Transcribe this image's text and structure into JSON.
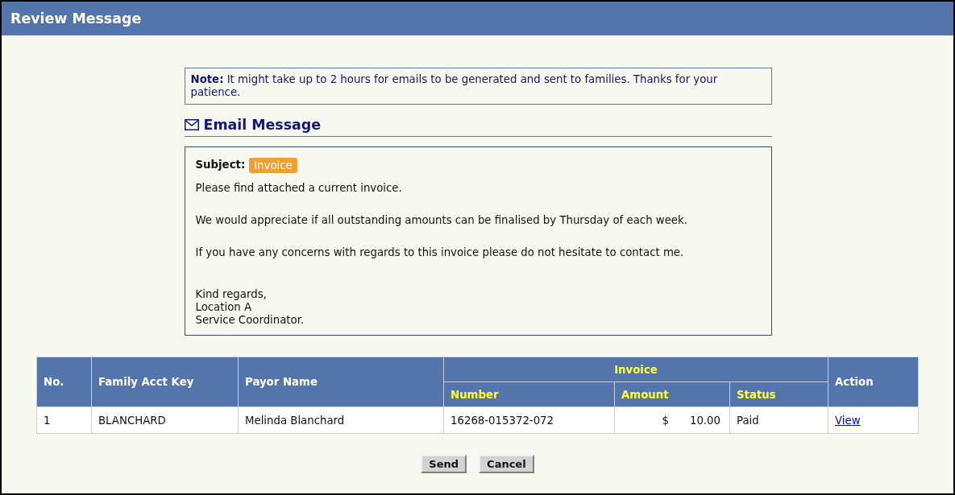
{
  "header": {
    "title": "Review Message"
  },
  "note": {
    "text": "**Note:** It might take up to 2 hours for emails to be generated and sent to families. Thanks for your patience."
  },
  "email_message": {
    "heading": "Email Message",
    "subject_label": "Subject:",
    "subject": "Invoice",
    "paragraphs": [
      "Please find attached a current invoice.",
      "We would appreciate if all outstanding amounts can be finalised by Thursday of each week.",
      "If you have any concerns with regards to this invoice please do not hesitate to contact me."
    ],
    "signature_lines": [
      "Kind regards,",
      "Location A",
      "Service Coordinator."
    ]
  },
  "table": {
    "column_group": {
      "label": "Invoice"
    },
    "columns": [
      {
        "label": "No.",
        "grouped": false
      },
      {
        "label": "Family Acct Key",
        "grouped": false
      },
      {
        "label": "Payor Name",
        "grouped": false
      },
      {
        "label": "Number",
        "grouped": true
      },
      {
        "label": "Amount",
        "grouped": true
      },
      {
        "label": "Status",
        "grouped": true
      },
      {
        "label": "Action",
        "grouped": false
      }
    ],
    "rows": [
      {
        "cells": [
          {
            "kind": "text",
            "text": "1"
          },
          {
            "kind": "text",
            "text": "BLANCHARD"
          },
          {
            "kind": "text",
            "text": "Melinda Blanchard"
          },
          {
            "kind": "text",
            "text": "16268-015372-072"
          },
          {
            "kind": "amount",
            "currency": "$",
            "value": "10.00"
          },
          {
            "kind": "text",
            "text": "Paid"
          },
          {
            "kind": "link",
            "text": "View"
          }
        ]
      }
    ]
  },
  "buttons": [
    "Send",
    "Cancel"
  ]
}
